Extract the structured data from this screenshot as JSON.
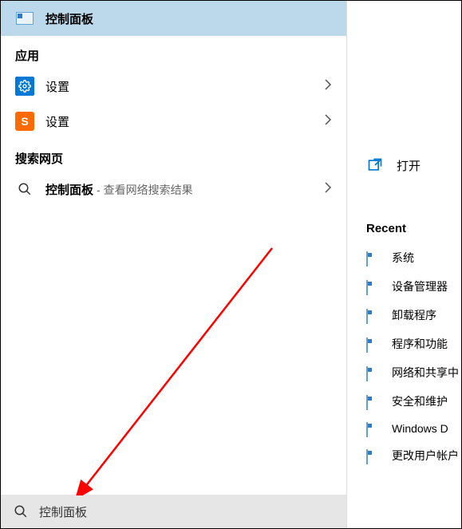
{
  "best_match": {
    "label": "控制面板"
  },
  "sections": {
    "apps_header": "应用",
    "web_header": "搜索网页"
  },
  "app_items": [
    {
      "label": "设置"
    },
    {
      "label": "设置"
    }
  ],
  "web_item": {
    "label": "控制面板",
    "sublabel": "- 查看网络搜索结果"
  },
  "search": {
    "value": "控制面板"
  },
  "right": {
    "open_label": "打开",
    "recent_header": "Recent",
    "recent_items": [
      "系统",
      "设备管理器",
      "卸载程序",
      "程序和功能",
      "网络和共享中",
      "安全和维护",
      "Windows D",
      "更改用户帐户"
    ]
  }
}
